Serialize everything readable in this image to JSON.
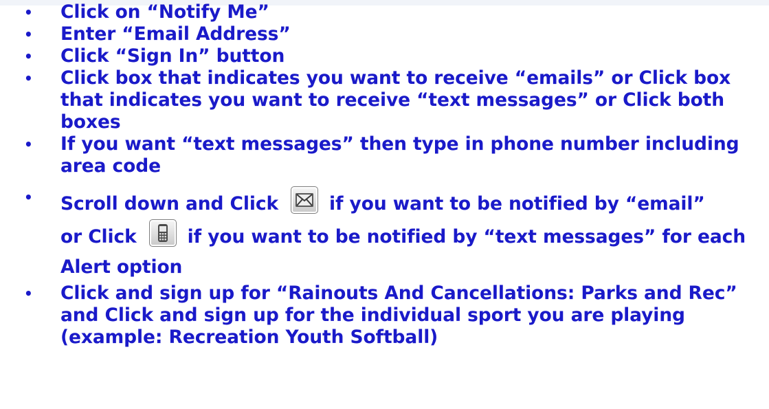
{
  "steps": [
    {
      "text": "Click on “Notify Me”"
    },
    {
      "text": "Enter “Email Address”"
    },
    {
      "text": "Click “Sign In” button"
    },
    {
      "text": "Click box that indicates you want to receive “emails” or Click box that indicates you want to receive “text messages” or Click both boxes"
    },
    {
      "text": "If you want “text messages” then type in phone number including area code"
    },
    {
      "part1": "Scroll down and Click",
      "part2": "if you want to be notified by “email”",
      "part3": "or Click",
      "part4": "if you want to be notified by “text messages” for each Alert option",
      "icon_email": "email-envelope-icon",
      "icon_text": "mobile-phone-icon"
    },
    {
      "text": "Click and sign up for “Rainouts And Cancellations: Parks and Rec” and Click and sign up for the individual sport you are playing (example: Recreation Youth Softball)"
    }
  ],
  "colors": {
    "text": "#1a1ac9",
    "top_band": "#f1f4f9"
  }
}
